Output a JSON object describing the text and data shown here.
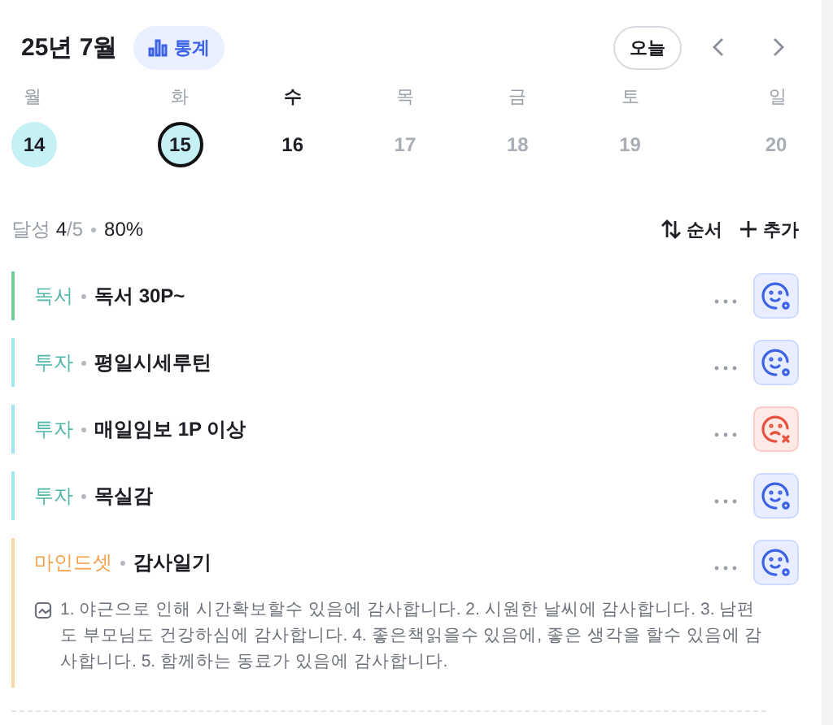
{
  "header": {
    "month": "25년 7월",
    "stats_button": "통계",
    "today_button": "오늘"
  },
  "week": [
    {
      "weekday": "월",
      "date": "14",
      "filled": true,
      "selected": false,
      "today": false,
      "future": false
    },
    {
      "weekday": "화",
      "date": "15",
      "filled": true,
      "selected": true,
      "today": false,
      "future": false
    },
    {
      "weekday": "수",
      "date": "16",
      "filled": false,
      "selected": false,
      "today": true,
      "future": false
    },
    {
      "weekday": "목",
      "date": "17",
      "filled": false,
      "selected": false,
      "today": false,
      "future": true
    },
    {
      "weekday": "금",
      "date": "18",
      "filled": false,
      "selected": false,
      "today": false,
      "future": true
    },
    {
      "weekday": "토",
      "date": "19",
      "filled": false,
      "selected": false,
      "today": false,
      "future": true
    },
    {
      "weekday": "일",
      "date": "20",
      "filled": false,
      "selected": false,
      "today": false,
      "future": true
    }
  ],
  "summary": {
    "label": "달성",
    "count": "4",
    "total": "/5",
    "percent": "80%",
    "sort_button": "순서",
    "add_button": "추가"
  },
  "habits": [
    {
      "category": "독서",
      "color": "#6fcf97",
      "title": "독서 30P~",
      "success": true
    },
    {
      "category": "투자",
      "color": "#9ee6f0",
      "title": "평일시세루틴",
      "success": true
    },
    {
      "category": "투자",
      "color": "#9ee6f0",
      "title": "매일임보 1P 이상",
      "success": false
    },
    {
      "category": "투자",
      "color": "#9ee6f0",
      "title": "목실감",
      "success": true
    },
    {
      "category": "마인드셋",
      "color": "#fdd9a8",
      "title": "감사일기",
      "success": true,
      "note": "1. 야근으로 인해 시간확보할수 있음에 감사합니다. 2. 시원한 날씨에 감사합니다. 3. 남편도 부모님도 건강하심에 감사합니다. 4. 좋은책읽을수 있음에, 좋은 생각을 할수 있음에 감사합니다. 5. 함께하는 동료가 있음에 감사합니다."
    }
  ]
}
